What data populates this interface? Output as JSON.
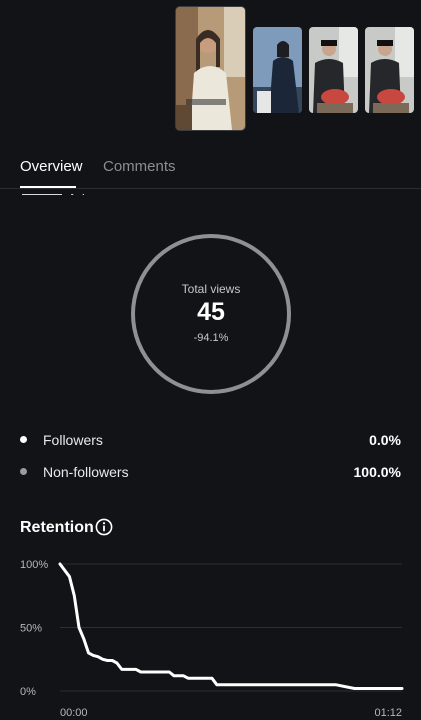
{
  "thumbnails": [
    {
      "name": "Thumbnail 1",
      "selected": true,
      "palette": [
        "#caa27a",
        "#e8e2d2",
        "#5a4a3c"
      ]
    },
    {
      "name": "Thumbnail 2",
      "selected": false,
      "palette": [
        "#6c87a8",
        "#1d2a3d",
        "#b8c6d8"
      ]
    },
    {
      "name": "Thumbnail 3",
      "selected": false,
      "palette": [
        "#c7c9c6",
        "#232325",
        "#c64b45"
      ]
    },
    {
      "name": "Thumbnail 4",
      "selected": false,
      "palette": [
        "#c7c9c6",
        "#232325",
        "#c64b45"
      ]
    }
  ],
  "tabs": [
    {
      "label": "Overview",
      "active": true
    },
    {
      "label": "Comments",
      "active": false
    }
  ],
  "views": {
    "label": "Total views",
    "value": "45",
    "change": "-94.1%"
  },
  "audience": [
    {
      "label": "Followers",
      "value": "0.0%",
      "color": "#ffffff"
    },
    {
      "label": "Non-followers",
      "value": "100.0%",
      "color": "#9a9ca1"
    }
  ],
  "retention": {
    "title": "Retention"
  },
  "colors": {
    "background": "#111316",
    "line": "#ffffff",
    "grid": "#2c2f33",
    "ring": "#8e9096"
  },
  "chart_data": {
    "type": "line",
    "title": "Retention",
    "ylim": [
      0,
      100
    ],
    "y_ticks": [
      "100%",
      "50%",
      "0%"
    ],
    "x_ticks": [
      "00:00",
      "01:12"
    ],
    "x_unit": "seconds",
    "xlim": [
      0,
      72
    ],
    "grid": true,
    "series": [
      {
        "x": [
          0,
          2,
          3,
          4,
          5,
          6,
          7,
          8,
          9,
          10,
          11,
          12,
          13,
          14,
          15,
          16,
          17,
          18,
          19,
          20,
          21,
          22,
          23,
          24,
          25,
          26,
          27,
          28,
          29,
          30,
          31,
          32,
          33,
          34,
          35,
          38,
          42,
          46,
          50,
          54,
          58,
          62,
          66,
          70,
          72
        ],
        "y": [
          100,
          90,
          75,
          50,
          41,
          30,
          28,
          27,
          25,
          24,
          24,
          22,
          17,
          17,
          17,
          17,
          15,
          15,
          15,
          15,
          15,
          15,
          15,
          12,
          12,
          12,
          10,
          10,
          10,
          10,
          10,
          10,
          5,
          5,
          5,
          5,
          5,
          5,
          5,
          5,
          5,
          2,
          2,
          2,
          2
        ]
      }
    ]
  }
}
